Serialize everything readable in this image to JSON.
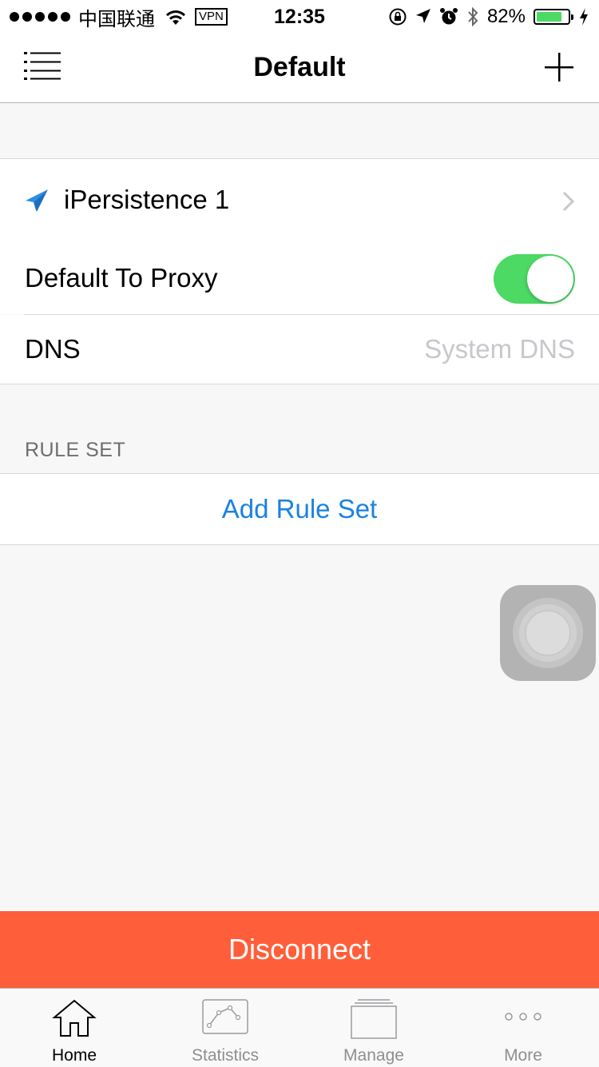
{
  "status_bar": {
    "carrier": "中国联通",
    "vpn": "VPN",
    "time": "12:35",
    "battery": "82%",
    "battery_level": 0.82
  },
  "nav": {
    "title": "Default",
    "menu_icon": "list-icon",
    "add_icon": "plus-icon"
  },
  "proxy_row": {
    "icon": "paper-plane-icon",
    "label": "iPersistence 1",
    "icon_color": "#2d8fe0"
  },
  "settings": {
    "default_to_proxy_label": "Default To Proxy",
    "default_to_proxy_on": true,
    "dns_label": "DNS",
    "dns_value": "System DNS"
  },
  "rule_set": {
    "header": "RULE SET",
    "add_label": "Add Rule Set"
  },
  "action": {
    "disconnect_label": "Disconnect",
    "color": "#ff5e3a"
  },
  "tabs": [
    {
      "label": "Home",
      "icon": "home-icon",
      "active": true
    },
    {
      "label": "Statistics",
      "icon": "statistics-icon",
      "active": false
    },
    {
      "label": "Manage",
      "icon": "manage-icon",
      "active": false
    },
    {
      "label": "More",
      "icon": "more-icon",
      "active": false
    }
  ],
  "colors": {
    "accent": "#1a82e2",
    "toggle_on": "#4cd964"
  }
}
